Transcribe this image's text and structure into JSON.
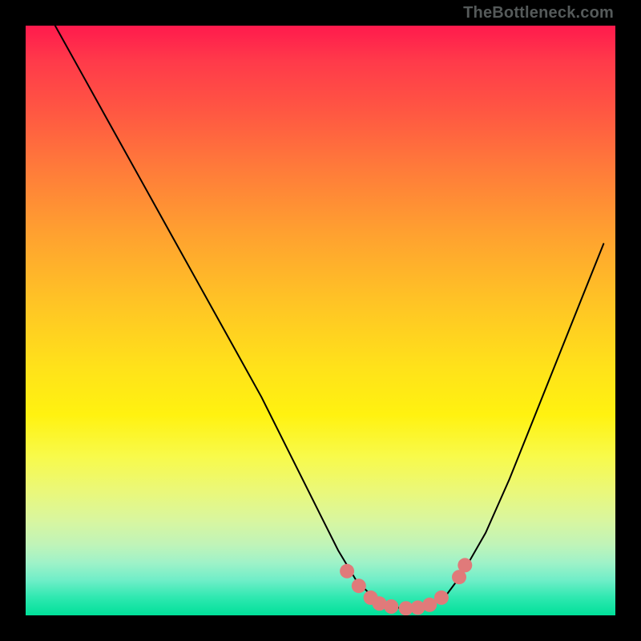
{
  "watermark": "TheBottleneck.com",
  "chart_data": {
    "type": "line",
    "title": "",
    "xlabel": "",
    "ylabel": "",
    "x_range": [
      0,
      1
    ],
    "y_range": [
      0,
      1
    ],
    "series": [
      {
        "name": "curve",
        "color": "#000000",
        "stroke_width": 2,
        "x": [
          0.05,
          0.1,
          0.15,
          0.2,
          0.25,
          0.3,
          0.35,
          0.4,
          0.45,
          0.5,
          0.53,
          0.56,
          0.59,
          0.62,
          0.65,
          0.68,
          0.71,
          0.74,
          0.78,
          0.82,
          0.86,
          0.9,
          0.94,
          0.98
        ],
        "y": [
          1.0,
          0.91,
          0.82,
          0.73,
          0.64,
          0.55,
          0.46,
          0.37,
          0.27,
          0.17,
          0.11,
          0.06,
          0.03,
          0.015,
          0.01,
          0.015,
          0.03,
          0.07,
          0.14,
          0.23,
          0.33,
          0.43,
          0.53,
          0.63
        ],
        "comment": "y is fraction of plot height from bottom; curve descends from top-left, rounds near bottom around x≈0.64, rises toward top-right"
      },
      {
        "name": "highlight-dots",
        "color": "#e07a7a",
        "marker_radius": 9,
        "x": [
          0.545,
          0.565,
          0.585,
          0.6,
          0.62,
          0.645,
          0.665,
          0.685,
          0.705,
          0.735,
          0.745
        ],
        "y": [
          0.075,
          0.05,
          0.03,
          0.02,
          0.015,
          0.012,
          0.013,
          0.018,
          0.03,
          0.065,
          0.085
        ],
        "comment": "pink rounded marker band along the trough of the curve"
      }
    ],
    "background_gradient_direction": "vertical",
    "background_gradient": [
      {
        "stop": 0.0,
        "color": "#ff1a4d"
      },
      {
        "stop": 0.5,
        "color": "#ffd020"
      },
      {
        "stop": 0.85,
        "color": "#d8f6a0"
      },
      {
        "stop": 1.0,
        "color": "#00e09a"
      }
    ],
    "frame_color": "#000000",
    "frame_thickness_px": 32
  }
}
